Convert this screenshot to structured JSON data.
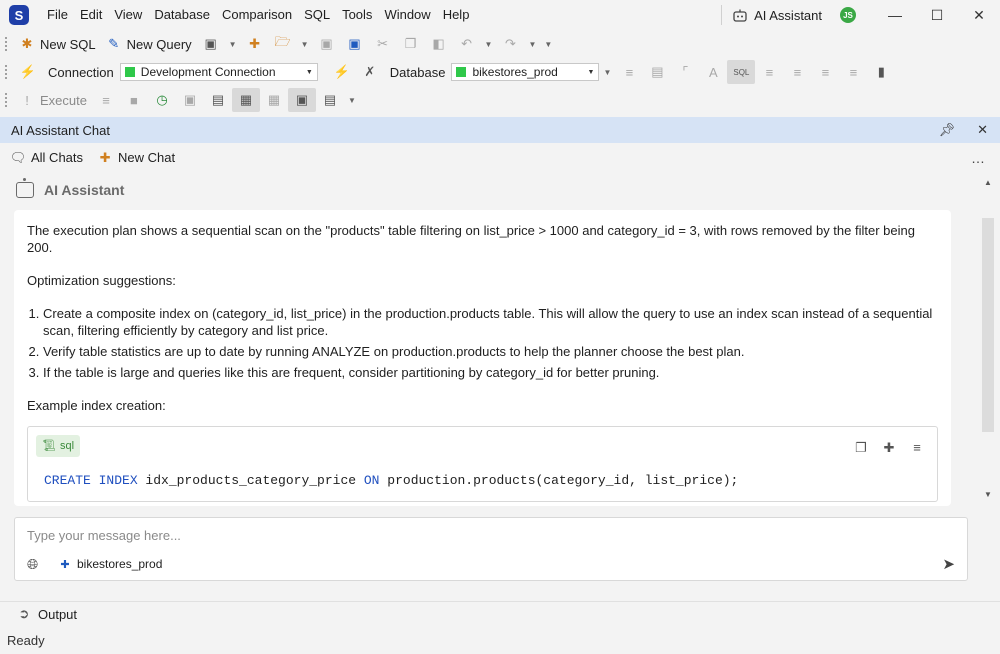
{
  "app": {
    "logo_letter": "S",
    "menu": [
      "File",
      "Edit",
      "View",
      "Database",
      "Comparison",
      "SQL",
      "Tools",
      "Window",
      "Help"
    ],
    "ai_assistant_label": "AI Assistant",
    "user_initials": "JS",
    "window_controls": [
      "minimize-icon",
      "maximize-icon",
      "close-icon"
    ]
  },
  "toolbar1": {
    "new_sql": "New SQL",
    "new_query": "New Query"
  },
  "toolbar2": {
    "connection_label": "Connection",
    "connection_value": "Development Connection",
    "database_label": "Database",
    "database_value": "bikestores_prod",
    "status_color": "#2fc84a"
  },
  "toolbar3": {
    "execute": "Execute"
  },
  "panel": {
    "title": "AI Assistant Chat",
    "all_chats": "All Chats",
    "new_chat": "New Chat"
  },
  "chat": {
    "assistant_name": "AI Assistant",
    "intro": "The execution plan shows a sequential scan on the \"products\" table filtering on list_price > 1000 and category_id = 3, with rows removed by the filter being 200.",
    "suggestions_heading": "Optimization suggestions:",
    "suggestions": [
      "Create a composite index on (category_id, list_price) in the production.products table. This will allow the query to use an index scan instead of a sequential scan, filtering efficiently by category and list price.",
      "Verify table statistics are up to date by running ANALYZE on production.products to help the planner choose the best plan.",
      "If the table is large and queries like this are frequent, consider partitioning by category_id for better pruning."
    ],
    "example_heading": "Example index creation:",
    "code_lang": "sql",
    "code": {
      "kw1": "CREATE INDEX",
      "name": " idx_products_category_price ",
      "kw2": "ON",
      "rest": " production.products(category_id, list_price);"
    }
  },
  "input": {
    "placeholder": "Type your message here...",
    "database_chip": "bikestores_prod"
  },
  "output_label": "Output",
  "status": "Ready"
}
